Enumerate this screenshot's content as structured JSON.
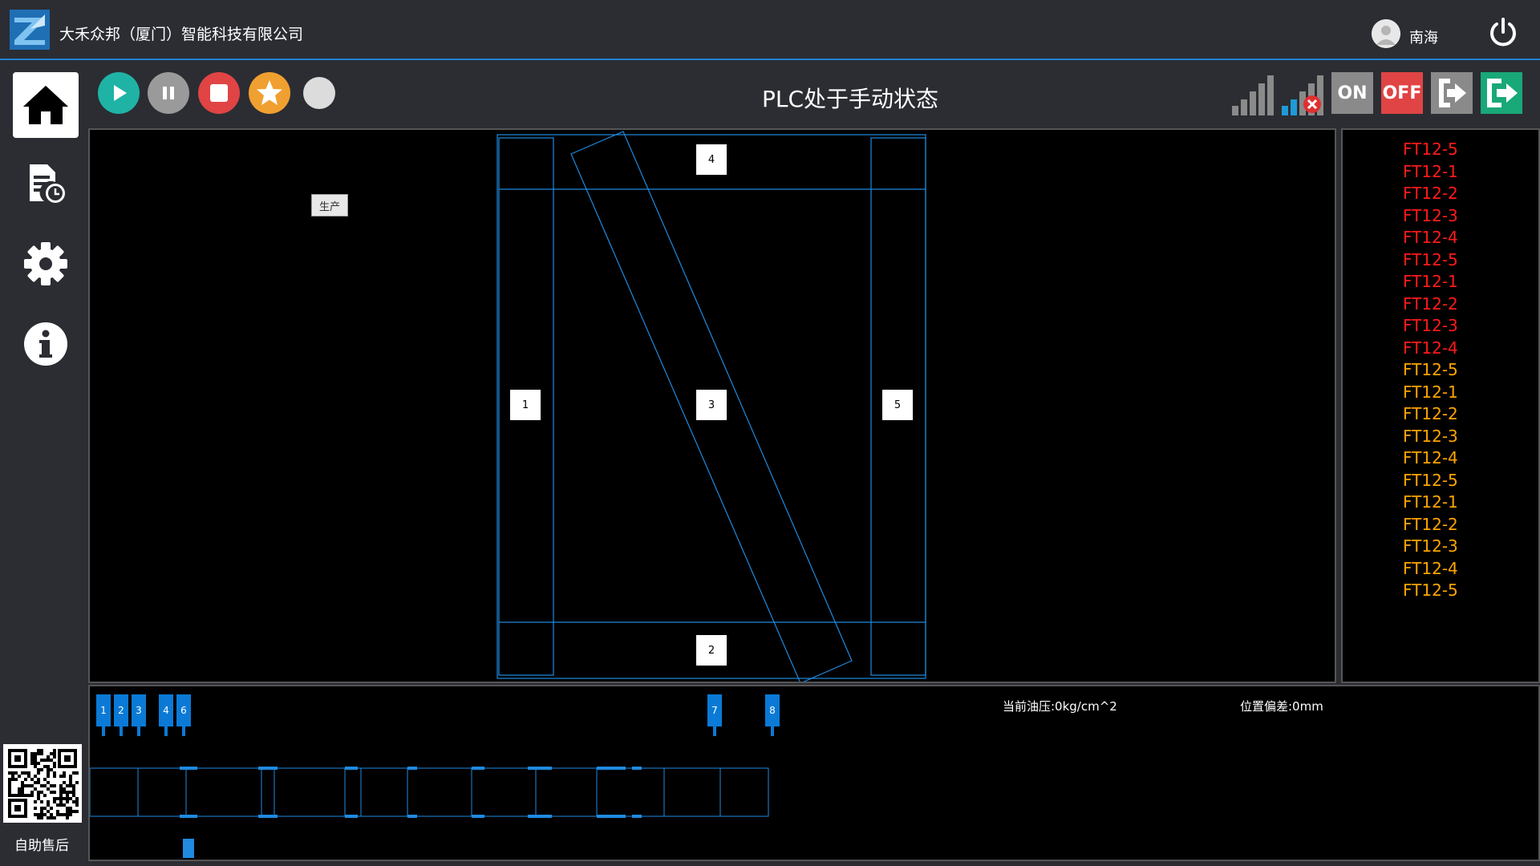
{
  "header": {
    "company": "大禾众邦（厦门）智能科技有限公司",
    "username": "南海"
  },
  "toolbar": {
    "plc_status": "PLC处于手动状态",
    "on_label": "ON",
    "off_label": "OFF"
  },
  "sidebar": {
    "qr_label": "自助售后"
  },
  "main": {
    "production_tag": "生产",
    "zones": {
      "z1": "1",
      "z2": "2",
      "z3": "3",
      "z4": "4",
      "z5": "5"
    }
  },
  "side_list": {
    "items": [
      {
        "label": "FT12-5",
        "color": "#ff1a1a"
      },
      {
        "label": "FT12-1",
        "color": "#ff1a1a"
      },
      {
        "label": "FT12-2",
        "color": "#ff1a1a"
      },
      {
        "label": "FT12-3",
        "color": "#ff1a1a"
      },
      {
        "label": "FT12-4",
        "color": "#ff1a1a"
      },
      {
        "label": "FT12-5",
        "color": "#ff1a1a"
      },
      {
        "label": "FT12-1",
        "color": "#ff1a1a"
      },
      {
        "label": "FT12-2",
        "color": "#ff1a1a"
      },
      {
        "label": "FT12-3",
        "color": "#ff1a1a"
      },
      {
        "label": "FT12-4",
        "color": "#ff1a1a"
      },
      {
        "label": "FT12-5",
        "color": "#ffa500"
      },
      {
        "label": "FT12-1",
        "color": "#ffa500"
      },
      {
        "label": "FT12-2",
        "color": "#ffa500"
      },
      {
        "label": "FT12-3",
        "color": "#ffa500"
      },
      {
        "label": "FT12-4",
        "color": "#ffa500"
      },
      {
        "label": "FT12-5",
        "color": "#ffa500"
      },
      {
        "label": "FT12-1",
        "color": "#ffa500"
      },
      {
        "label": "FT12-2",
        "color": "#ffa500"
      },
      {
        "label": "FT12-3",
        "color": "#ffa500"
      },
      {
        "label": "FT12-4",
        "color": "#ffa500"
      },
      {
        "label": "FT12-5",
        "color": "#ffa500"
      }
    ]
  },
  "bottom": {
    "oil_pressure": "当前油压:0kg/cm^2",
    "position_offset": "位置偏差:0mm",
    "markers": [
      "1",
      "2",
      "3",
      "4",
      "6",
      "7",
      "8"
    ]
  },
  "colors": {
    "accent": "#1f7fd0",
    "play": "#1fb3a6",
    "stop": "#e04444",
    "star": "#f0a030",
    "off": "#e04444",
    "exit": "#19a877"
  }
}
